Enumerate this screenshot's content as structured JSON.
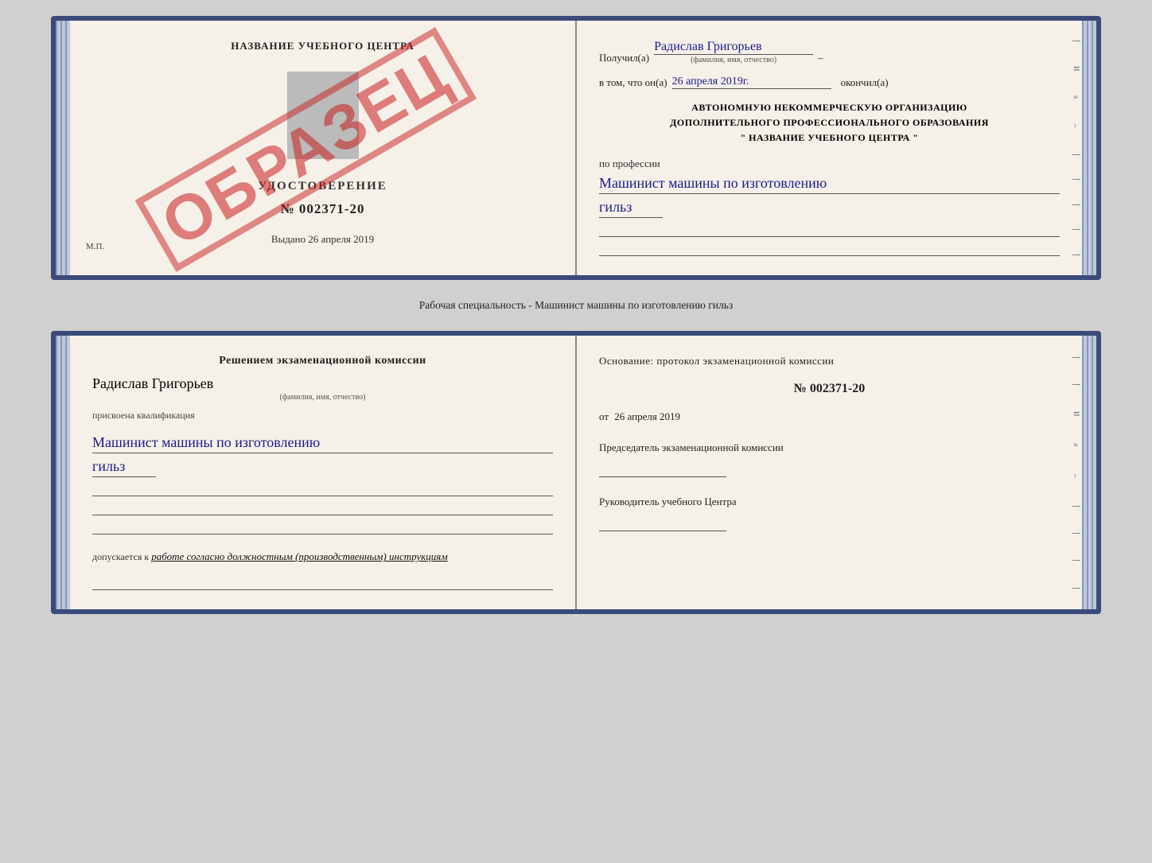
{
  "page": {
    "background": "#d0d0d0"
  },
  "top_doc": {
    "left": {
      "center_title": "НАЗВАНИЕ УЧЕБНОГО ЦЕНТРА",
      "cert_label": "УДОСТОВЕРЕНИЕ",
      "cert_number": "№ 002371-20",
      "watermark": "ОБРАЗЕЦ",
      "issued_label": "Выдано",
      "issued_date": "26 апреля 2019",
      "mp_label": "М.П."
    },
    "right": {
      "received_label": "Получил(а)",
      "recipient_name": "Радислав Григорьев",
      "name_sub": "(фамилия, имя, отчество)",
      "in_that_label": "в том, что он(а)",
      "completion_date": "26 апреля 2019г.",
      "finished_label": "окончил(а)",
      "org_line1": "АВТОНОМНУЮ НЕКОММЕРЧЕСКУЮ ОРГАНИЗАЦИЮ",
      "org_line2": "ДОПОЛНИТЕЛЬНОГО ПРОФЕССИОНАЛЬНОГО ОБРАЗОВАНИЯ",
      "org_quote": "\"    НАЗВАНИЕ УЧЕБНОГО ЦЕНТРА    \"",
      "profession_label": "по профессии",
      "profession_line1": "Машинист машины по изготовлению",
      "profession_line2": "гильз"
    }
  },
  "specialty_row": {
    "text": "Рабочая специальность - Машинист машины по изготовлению гильз"
  },
  "bottom_doc": {
    "left": {
      "decision_text": "Решением  экзаменационной  комиссии",
      "person_name": "Радислав Григорьев",
      "name_sub": "(фамилия, имя, отчество)",
      "assigned_label": "присвоена квалификация",
      "qualification_line1": "Машинист машины по изготовлению",
      "qualification_line2": "гильз",
      "допуск_label": "допускается к",
      "допуск_text": "работе согласно должностным (производственным) инструкциям"
    },
    "right": {
      "basis_label": "Основание: протокол экзаменационной  комиссии",
      "protocol_number": "№  002371-20",
      "date_prefix": "от",
      "protocol_date": "26 апреля 2019",
      "chairman_label": "Председатель экзаменационной комиссии",
      "director_label": "Руководитель учебного Центра"
    }
  }
}
